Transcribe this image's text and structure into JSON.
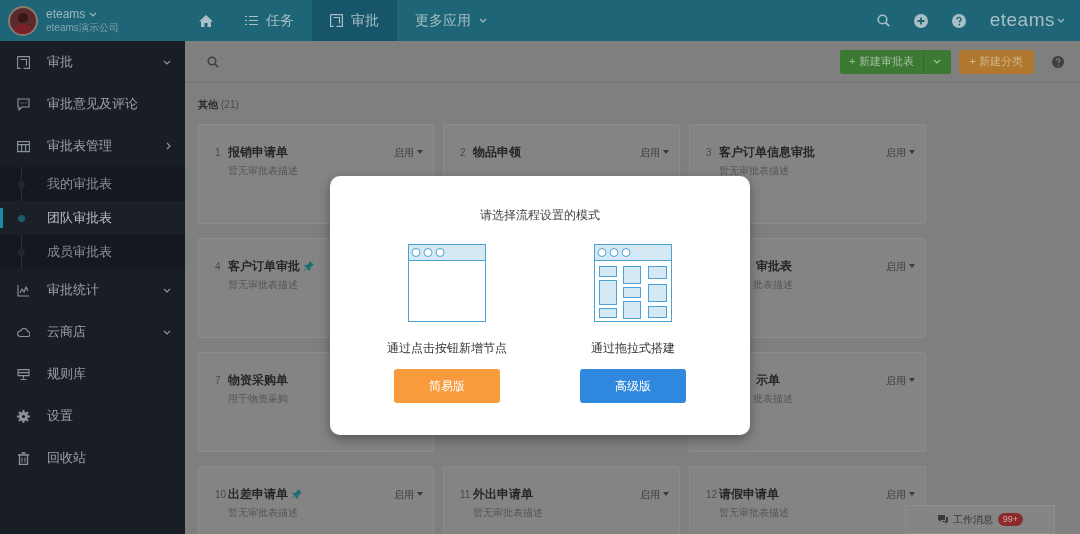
{
  "header": {
    "user_name": "eteams",
    "company": "eteams演示公司",
    "nav": [
      {
        "kind": "home",
        "selected": false
      },
      {
        "kind": "list",
        "label": "任务",
        "selected": false
      },
      {
        "kind": "form",
        "label": "审批",
        "selected": true
      },
      {
        "kind": "dropdown",
        "label": "更多应用",
        "selected": false
      }
    ],
    "logo": "eteams"
  },
  "sidebar": {
    "items": [
      {
        "label": "审批",
        "expanded": false
      },
      {
        "label": "审批意见及评论"
      },
      {
        "label": "审批表管理",
        "expanded": true,
        "children": [
          {
            "label": "我的审批表",
            "selected": false
          },
          {
            "label": "团队审批表",
            "selected": true
          },
          {
            "label": "成员审批表",
            "selected": false
          }
        ]
      },
      {
        "label": "审批统计",
        "expanded": false
      },
      {
        "label": "云商店",
        "expanded": false
      },
      {
        "label": "规则库"
      },
      {
        "label": "设置"
      },
      {
        "label": "回收站"
      }
    ]
  },
  "toolbar": {
    "buttons": [
      {
        "label": "+ 新建审批表",
        "kind": "split"
      },
      {
        "label": "+ 新建分类",
        "kind": "plain"
      }
    ]
  },
  "section": {
    "title": "其他",
    "count": "(21)"
  },
  "cards": [
    {
      "kind": "full",
      "number": "1",
      "title": "报销申请单",
      "description": "暂无审批表描述",
      "status": "启用",
      "pinned": false
    },
    {
      "kind": "full",
      "number": "2",
      "title": "物品申领",
      "status": "启用",
      "pinned": false
    },
    {
      "kind": "full",
      "number": "3",
      "title": "客户订单信息审批",
      "description": "暂无审批表描述",
      "status": "启用",
      "pinned": false
    },
    {
      "kind": "full",
      "number": "4",
      "title": "客户订单审批",
      "description": "暂无审批表描述",
      "pinned": true
    },
    {
      "kind": "partial",
      "title": "审批表",
      "description": "批表描述",
      "status": "启用",
      "pinned": false
    },
    {
      "kind": "full",
      "number": "7",
      "title": "物资采购单",
      "description": "用于物资采购",
      "pinned": false
    },
    {
      "kind": "partial",
      "title": "示单",
      "description": "批表描述",
      "status": "启用",
      "pinned": false
    },
    {
      "kind": "full",
      "number": "10",
      "title": "出差申请单",
      "description": "暂无审批表描述",
      "status": "启用",
      "pinned": true
    },
    {
      "kind": "full",
      "number": "11",
      "title": "外出申请单",
      "description": "暂无审批表描述",
      "status": "启用",
      "pinned": false
    },
    {
      "kind": "full",
      "number": "12",
      "title": "请假申请单",
      "description": "暂无审批表描述",
      "status": "启用",
      "pinned": false
    }
  ],
  "modal": {
    "title": "请选择流程设置的模式",
    "options": [
      {
        "kind": "simple",
        "caption": "通过点击按钮新增节点",
        "button": "简易版"
      },
      {
        "kind": "advanced",
        "caption": "通过拖拉式搭建",
        "button": "高级版"
      }
    ]
  },
  "messages": {
    "label": "工作消息",
    "badge": "99+"
  }
}
